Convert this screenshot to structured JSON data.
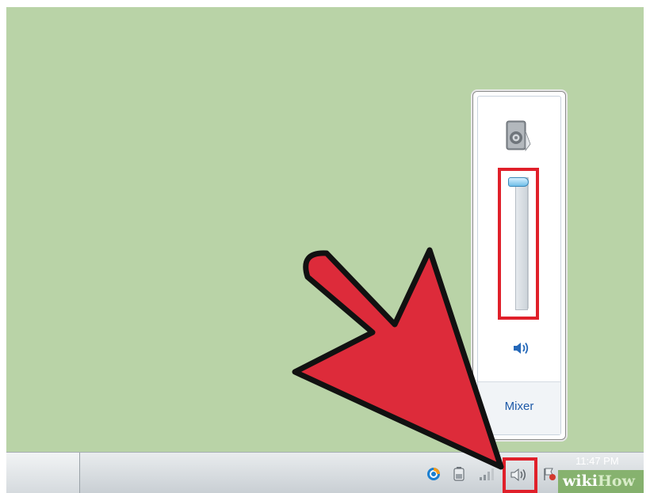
{
  "volume_flyout": {
    "mixer_label": "Mixer",
    "device_icon": "speaker-device-icon",
    "mute_icon": "speaker-volume-icon",
    "volume_level_percent": 100
  },
  "taskbar": {
    "clock_text": "11:47 PM",
    "tray_icons": [
      "program-circle-icon",
      "battery-icon",
      "network-signal-icon",
      "speaker-icon",
      "action-center-flag-icon"
    ]
  },
  "watermark": {
    "wiki": "wiki",
    "how": "How"
  },
  "colors": {
    "desktop": "#b9d3a7",
    "highlight_red": "#e0202a",
    "arrow_red": "#dd2b3a",
    "link_blue": "#1e5aa8"
  }
}
